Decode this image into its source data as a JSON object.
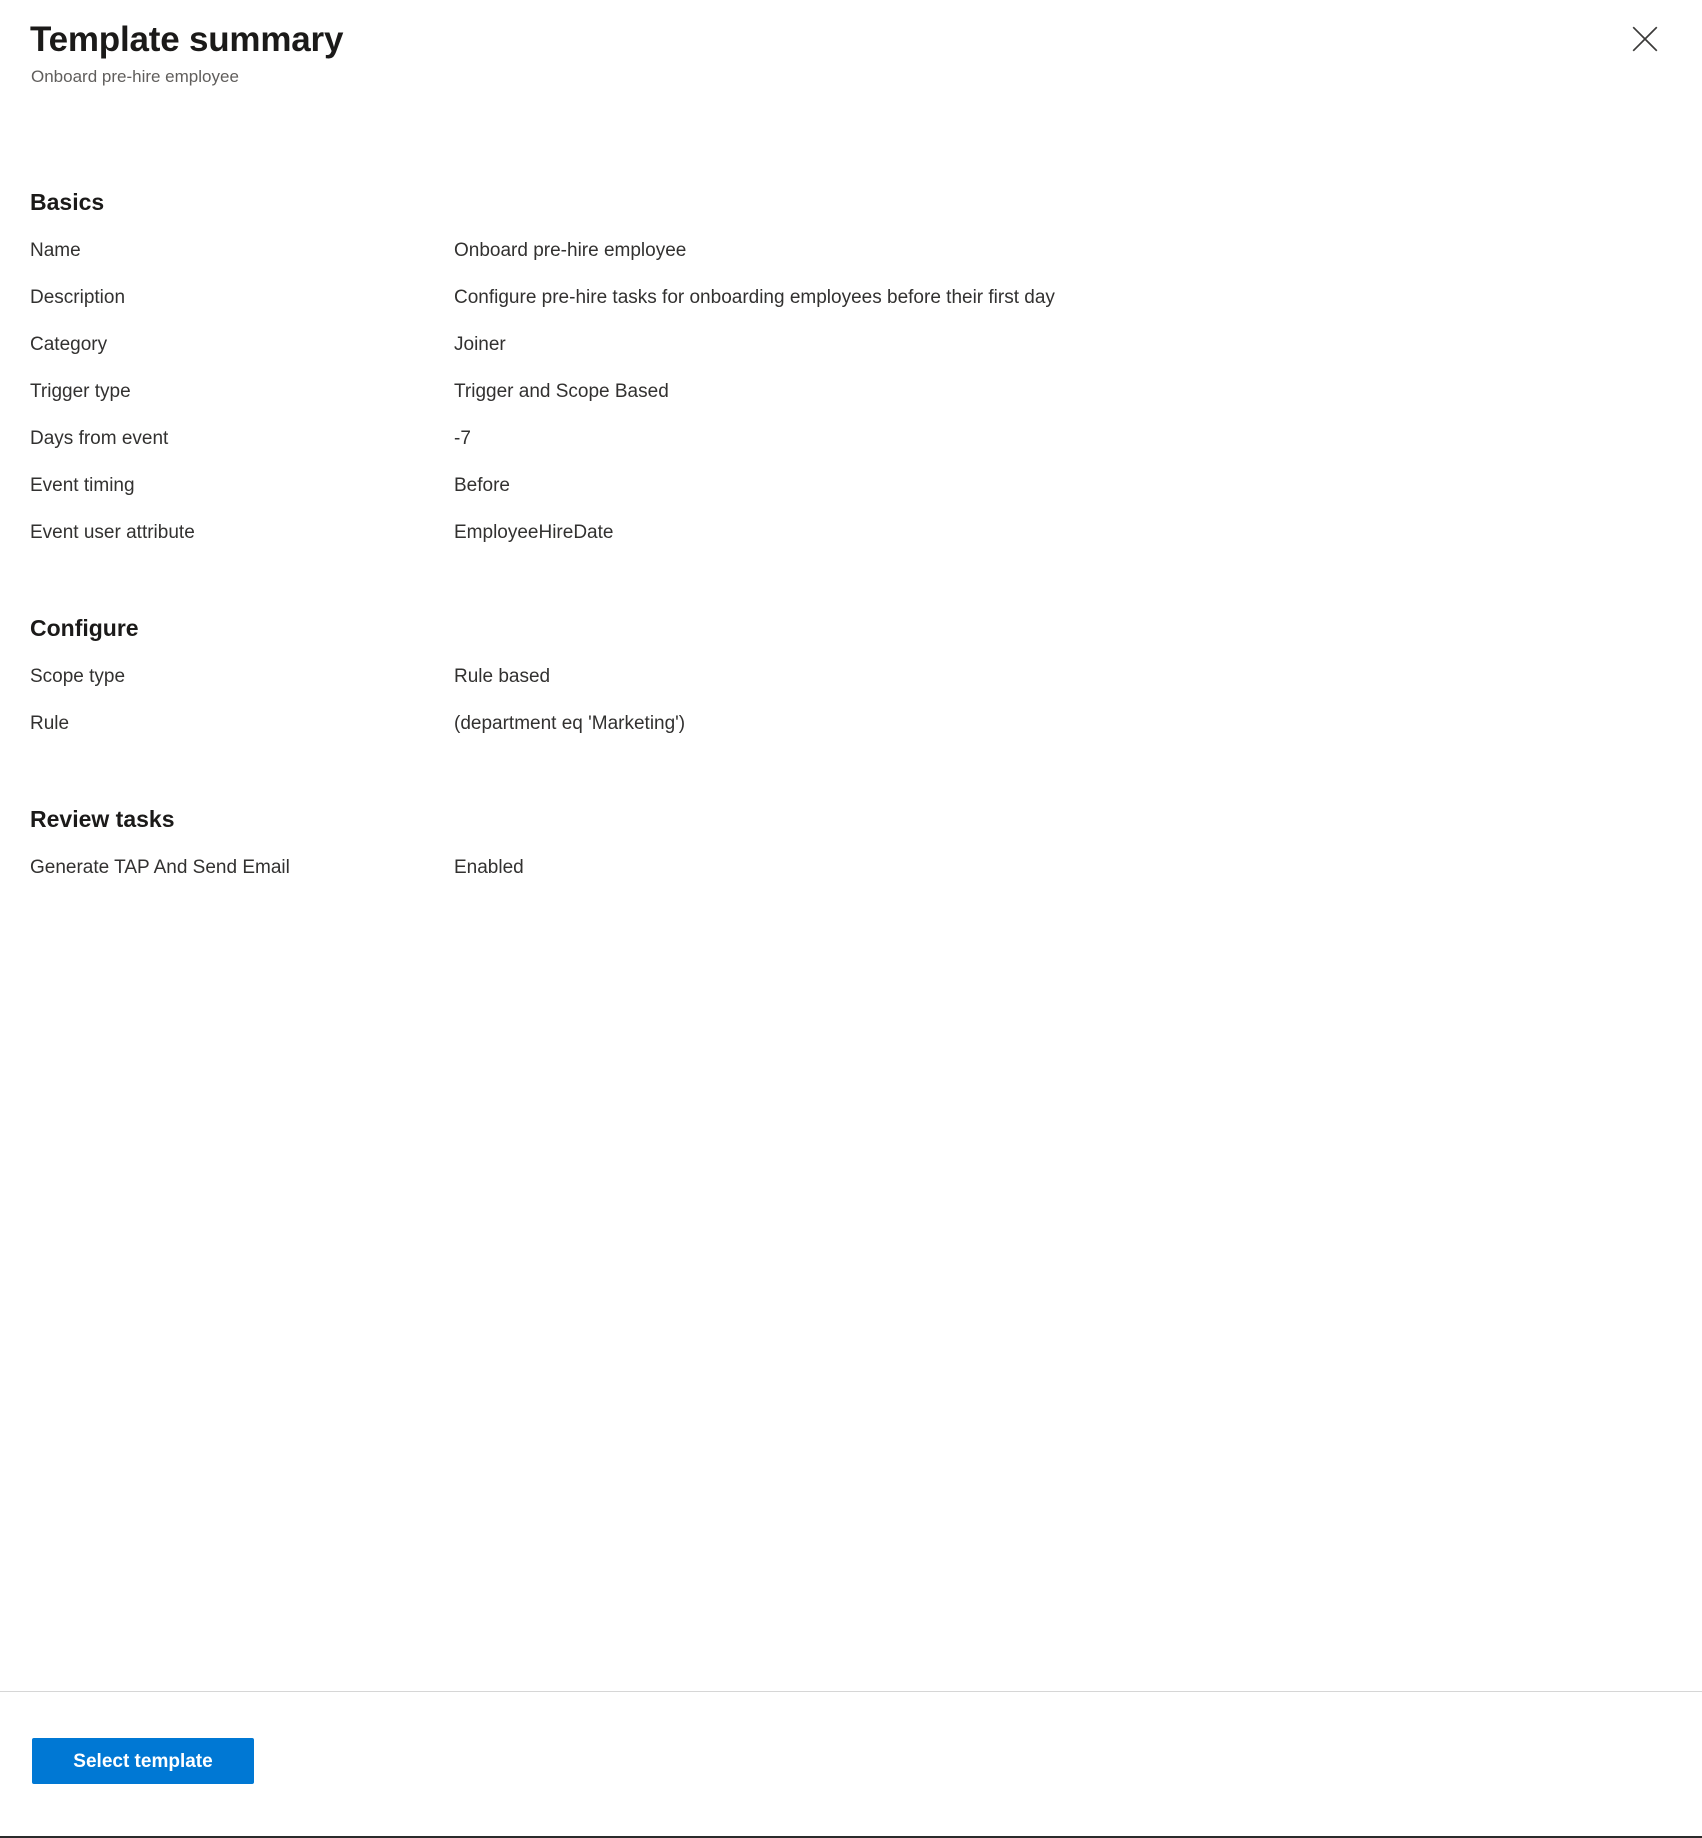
{
  "header": {
    "title": "Template summary",
    "subtitle": "Onboard pre-hire employee",
    "close_icon": "close-icon",
    "close_label": "Close"
  },
  "sections": [
    {
      "heading": "Basics",
      "rows": [
        {
          "label": "Name",
          "value": "Onboard pre-hire employee"
        },
        {
          "label": "Description",
          "value": "Configure pre-hire tasks for onboarding employees before their first day"
        },
        {
          "label": "Category",
          "value": "Joiner"
        },
        {
          "label": "Trigger type",
          "value": "Trigger and Scope Based"
        },
        {
          "label": "Days from event",
          "value": "-7"
        },
        {
          "label": "Event timing",
          "value": "Before"
        },
        {
          "label": "Event user attribute",
          "value": "EmployeeHireDate"
        }
      ]
    },
    {
      "heading": "Configure",
      "rows": [
        {
          "label": "Scope type",
          "value": "Rule based"
        },
        {
          "label": "Rule",
          "value": "(department eq 'Marketing')"
        }
      ]
    },
    {
      "heading": "Review tasks",
      "rows": [
        {
          "label": "Generate TAP And Send Email",
          "value": "Enabled"
        }
      ]
    }
  ],
  "footer": {
    "select_template_label": "Select template"
  },
  "colors": {
    "accent": "#0078d4",
    "title_text": "#1b1a19",
    "body_text": "#323130",
    "subtitle_text": "#605e5c",
    "divider": "#d6d6d6"
  }
}
